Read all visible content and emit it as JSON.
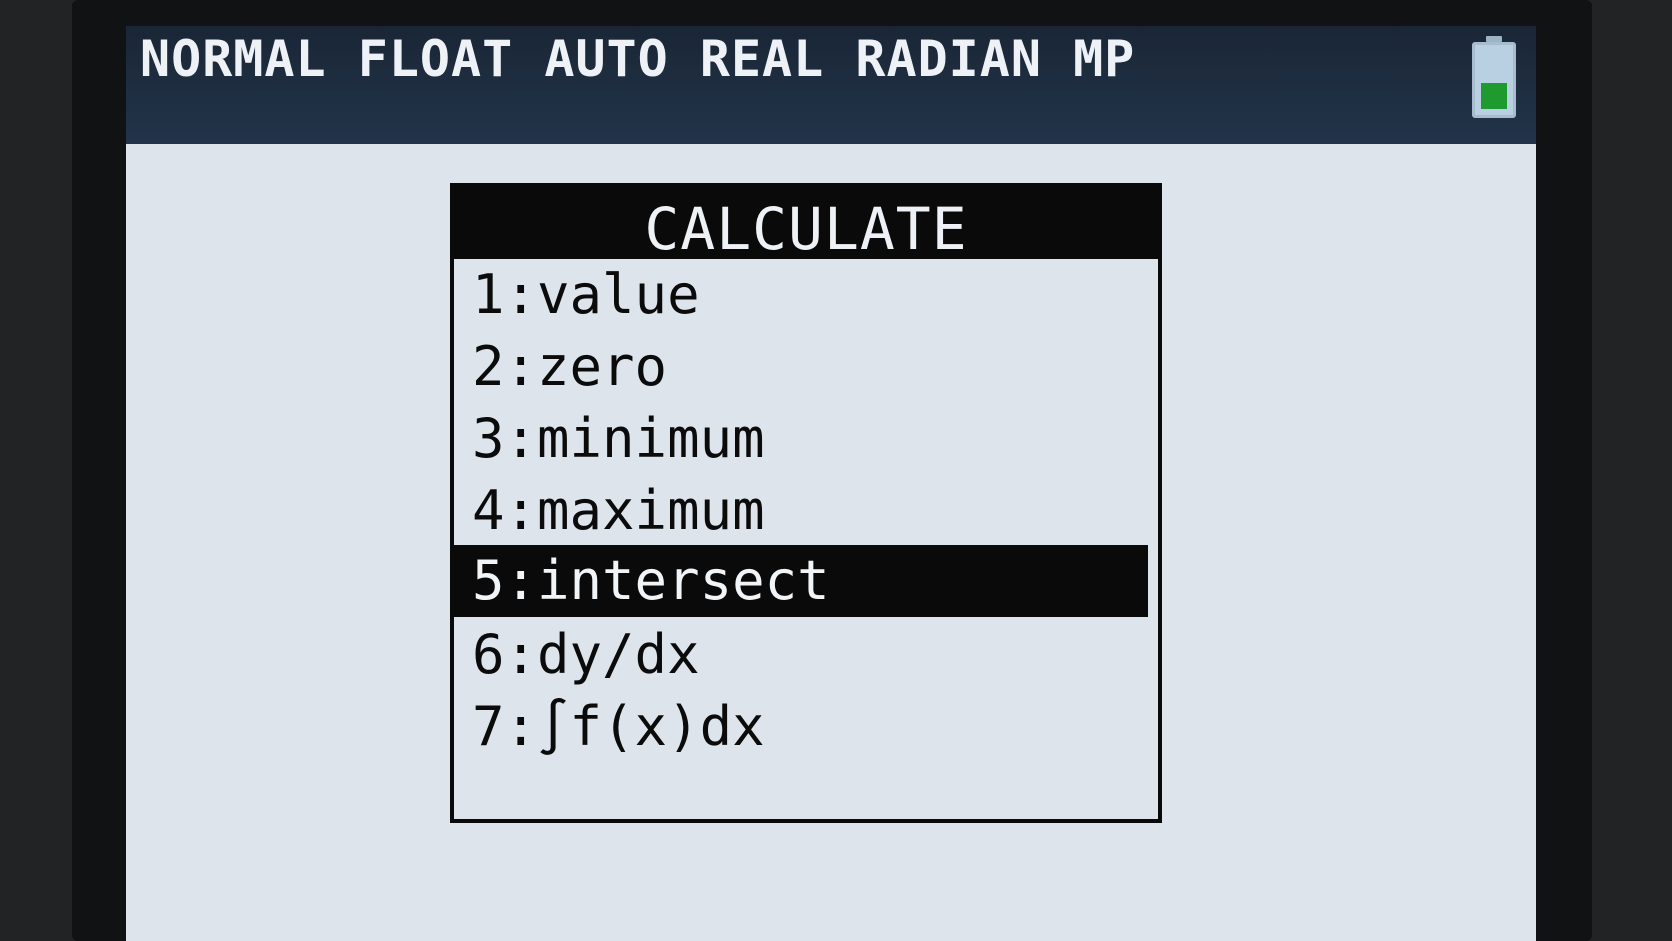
{
  "status_bar": {
    "text": "NORMAL FLOAT AUTO REAL RADIAN MP",
    "battery_level": 0.45,
    "battery_color": "#1e9a2e"
  },
  "menu": {
    "title": "CALCULATE",
    "selected_index": 4,
    "items": [
      {
        "label": "1:value"
      },
      {
        "label": "2:zero"
      },
      {
        "label": "3:minimum"
      },
      {
        "label": "4:maximum"
      },
      {
        "label": "5:intersect"
      },
      {
        "label": "6:dy/dx"
      },
      {
        "label": "7:∫f(x)dx"
      }
    ]
  }
}
